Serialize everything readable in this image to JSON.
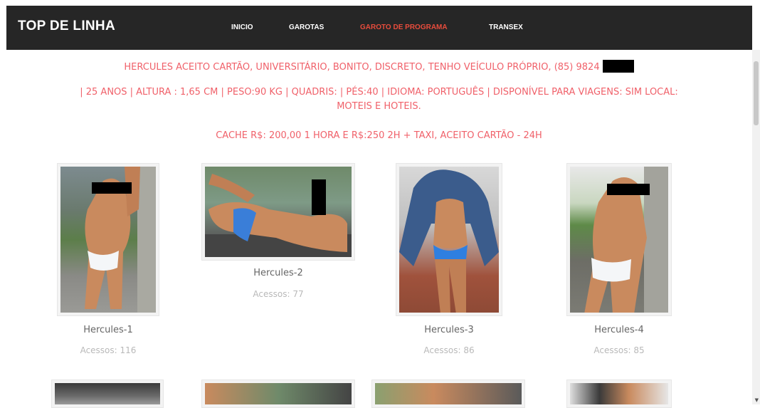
{
  "navbar": {
    "brand": "TOP DE LINHA",
    "items": [
      {
        "label": "INICIO"
      },
      {
        "label": "GAROTAS"
      },
      {
        "label": "GAROTO DE PROGRAMA"
      },
      {
        "label": "TRANSEX"
      }
    ],
    "active_color": "#e74c3c"
  },
  "profile": {
    "line1": "HERCULES ACEITO CARTÃO, UNIVERSITÁRIO, BONITO, DISCRETO, TENHO VEÍCULO PRÓPRIO, (85) 9824",
    "line2a": "| 25 ANOS | ALTURA : 1,65 CM | PESO:90 KG | QUADRIS:  | PÉS:40 | IDIOMA: PORTUGUÊS | DISPONÍVEL PARA VIAGENS: SIM LOCAL:",
    "line2b": "MOTEIS E HOTEIS.",
    "line3": "CACHE R$: 200,00 1 HORA E R$:250 2H + TAXI, ACEITO CARTÃO - 24H",
    "text_color": "#f0616a"
  },
  "gallery": [
    {
      "title": "Hercules-1",
      "views": "Acessos: 116"
    },
    {
      "title": "Hercules-2",
      "views": "Acessos: 77"
    },
    {
      "title": "Hercules-3",
      "views": "Acessos: 86"
    },
    {
      "title": "Hercules-4",
      "views": "Acessos: 85"
    }
  ]
}
